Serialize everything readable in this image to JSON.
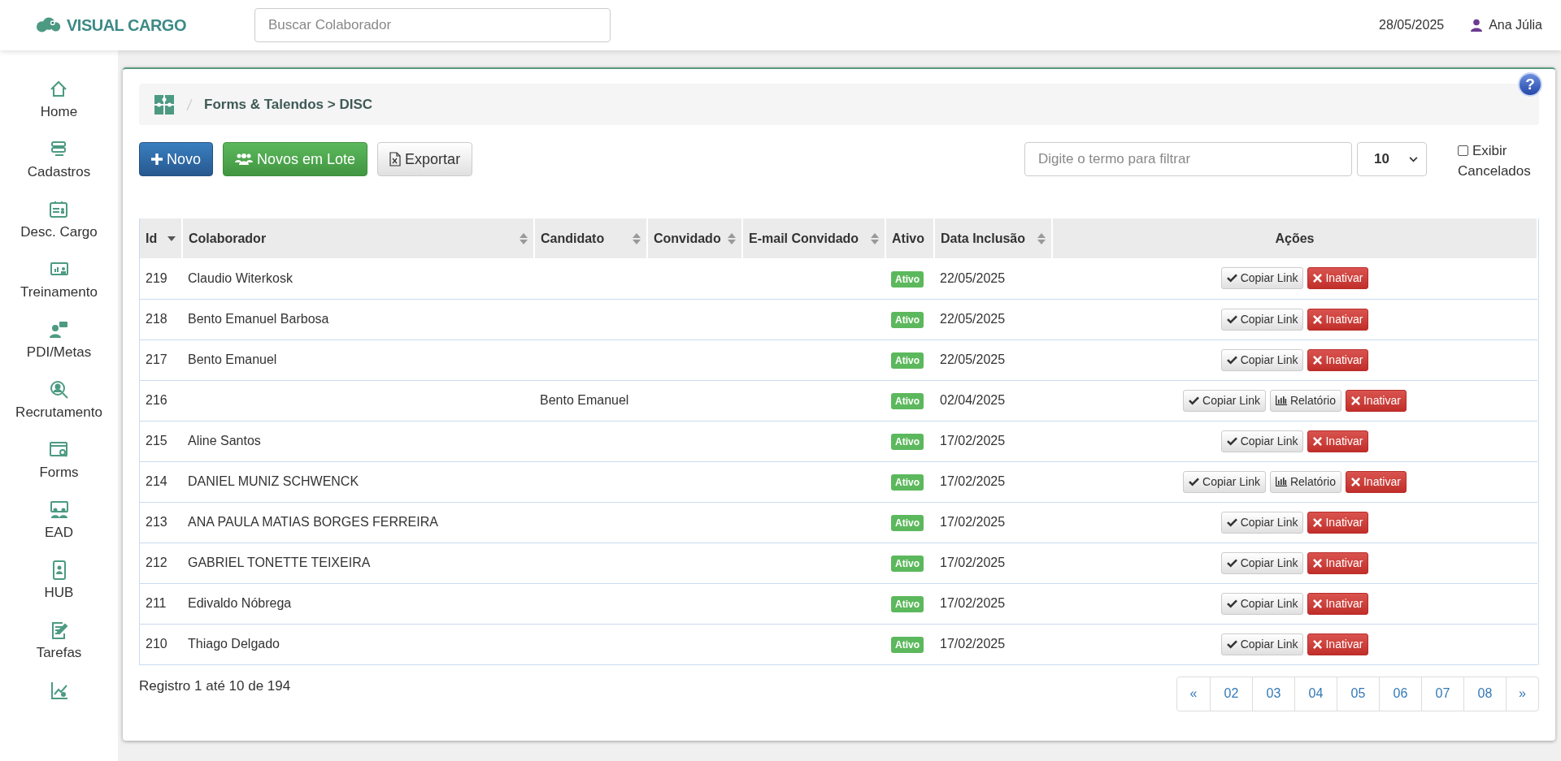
{
  "header": {
    "logo": "VISUAL CARGO",
    "search": {
      "placeholder": "Buscar Colaborador"
    },
    "date": "28/05/2025",
    "user": "Ana Júlia"
  },
  "sidebar": {
    "items": [
      {
        "kind": "labelled",
        "label": "Home"
      },
      {
        "kind": "labelled",
        "label": "Cadastros"
      },
      {
        "kind": "labelled",
        "label": "Desc. Cargo"
      },
      {
        "kind": "labelled",
        "label": "Treinamento"
      },
      {
        "kind": "labelled",
        "label": "PDI/Metas"
      },
      {
        "kind": "labelled",
        "label": "Recrutamento"
      },
      {
        "kind": "labelled",
        "label": "Forms"
      },
      {
        "kind": "labelled",
        "label": "EAD"
      },
      {
        "kind": "labelled",
        "label": "HUB"
      },
      {
        "kind": "labelled",
        "label": "Tarefas"
      },
      {
        "kind": "icon_only"
      }
    ]
  },
  "help": "?",
  "breadcrumb": "Forms & Talendos > DISC",
  "toolbar": {
    "buttons": [
      {
        "kind": "new",
        "label": "Novo"
      },
      {
        "kind": "batch",
        "label": "Novos em Lote"
      },
      {
        "kind": "export",
        "label": "Exportar"
      }
    ],
    "filter": {
      "placeholder": "Digite o termo para filtrar"
    },
    "page_size": "10",
    "show_cancelled": {
      "label": "Exibir Cancelados",
      "checked": false
    }
  },
  "table": {
    "columns": [
      {
        "label": "Id",
        "sortable": true,
        "sorted": true
      },
      {
        "label": "Colaborador",
        "sortable": true,
        "sorted": false
      },
      {
        "label": "Candidato",
        "sortable": true,
        "sorted": false
      },
      {
        "label": "Convidado",
        "sortable": true,
        "sorted": false
      },
      {
        "label": "E-mail Convidado",
        "sortable": true,
        "sorted": false
      },
      {
        "label": "Ativo",
        "sortable": false
      },
      {
        "label": "Data Inclusão",
        "sortable": true,
        "sorted": false
      },
      {
        "label": "Ações",
        "sortable": false
      }
    ],
    "rows": [
      {
        "id": "219",
        "colaborador": "Claudio Witerkosk",
        "status": "Ativo",
        "date": "22/05/2025",
        "actions": [
          {
            "kind": "copy",
            "label": "Copiar Link"
          },
          {
            "kind": "deactivate",
            "label": "Inativar"
          }
        ]
      },
      {
        "id": "218",
        "colaborador": "Bento Emanuel Barbosa",
        "status": "Ativo",
        "date": "22/05/2025",
        "actions": [
          {
            "kind": "copy",
            "label": "Copiar Link"
          },
          {
            "kind": "deactivate",
            "label": "Inativar"
          }
        ]
      },
      {
        "id": "217",
        "colaborador": "Bento Emanuel",
        "status": "Ativo",
        "date": "22/05/2025",
        "actions": [
          {
            "kind": "copy",
            "label": "Copiar Link"
          },
          {
            "kind": "deactivate",
            "label": "Inativar"
          }
        ]
      },
      {
        "id": "216",
        "candidato": "Bento Emanuel",
        "status": "Ativo",
        "date": "02/04/2025",
        "actions": [
          {
            "kind": "copy",
            "label": "Copiar Link"
          },
          {
            "kind": "report",
            "label": "Relatório"
          },
          {
            "kind": "deactivate",
            "label": "Inativar"
          }
        ]
      },
      {
        "id": "215",
        "colaborador": "Aline Santos",
        "status": "Ativo",
        "date": "17/02/2025",
        "actions": [
          {
            "kind": "copy",
            "label": "Copiar Link"
          },
          {
            "kind": "deactivate",
            "label": "Inativar"
          }
        ]
      },
      {
        "id": "214",
        "colaborador": "DANIEL MUNIZ SCHWENCK",
        "status": "Ativo",
        "date": "17/02/2025",
        "actions": [
          {
            "kind": "copy",
            "label": "Copiar Link"
          },
          {
            "kind": "report",
            "label": "Relatório"
          },
          {
            "kind": "deactivate",
            "label": "Inativar"
          }
        ]
      },
      {
        "id": "213",
        "colaborador": "ANA PAULA MATIAS BORGES FERREIRA",
        "status": "Ativo",
        "date": "17/02/2025",
        "actions": [
          {
            "kind": "copy",
            "label": "Copiar Link"
          },
          {
            "kind": "deactivate",
            "label": "Inativar"
          }
        ]
      },
      {
        "id": "212",
        "colaborador": "GABRIEL TONETTE TEIXEIRA",
        "status": "Ativo",
        "date": "17/02/2025",
        "actions": [
          {
            "kind": "copy",
            "label": "Copiar Link"
          },
          {
            "kind": "deactivate",
            "label": "Inativar"
          }
        ]
      },
      {
        "id": "211",
        "colaborador": "Edivaldo Nóbrega",
        "status": "Ativo",
        "date": "17/02/2025",
        "actions": [
          {
            "kind": "copy",
            "label": "Copiar Link"
          },
          {
            "kind": "deactivate",
            "label": "Inativar"
          }
        ]
      },
      {
        "id": "210",
        "colaborador": "Thiago Delgado",
        "status": "Ativo",
        "date": "17/02/2025",
        "actions": [
          {
            "kind": "copy",
            "label": "Copiar Link"
          },
          {
            "kind": "deactivate",
            "label": "Inativar"
          }
        ]
      }
    ]
  },
  "footer": {
    "summary": "Registro 1 até 10 de 194",
    "pagination": [
      {
        "label": "«",
        "selected": false
      },
      {
        "label": "02",
        "selected": false
      },
      {
        "label": "03",
        "selected": false
      },
      {
        "label": "04",
        "selected": false
      },
      {
        "label": "05",
        "selected": false
      },
      {
        "label": "06",
        "selected": false
      },
      {
        "label": "07",
        "selected": false
      },
      {
        "label": "08",
        "selected": false
      },
      {
        "label": "»",
        "selected": false
      }
    ]
  }
}
